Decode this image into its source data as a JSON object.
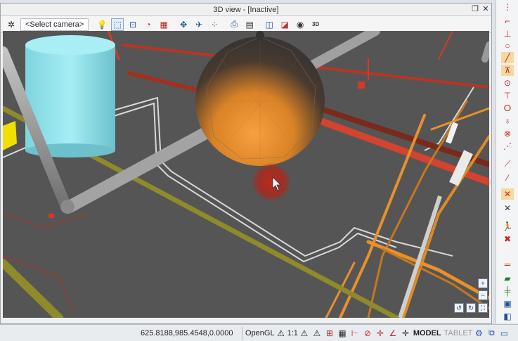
{
  "window": {
    "title": "3D view - [Inactive]",
    "restore_glyph": "❐",
    "close_glyph": "✕"
  },
  "toolbar": {
    "camera_select": "<Select camera>",
    "three_d_label": "3D",
    "icons": [
      "camera-settings-icon",
      "bulb-icon",
      "zoom-window-icon",
      "zoom-extents-icon",
      "orbit-2x-icon",
      "wall-icon",
      "walk-icon",
      "fly-icon",
      "path-icon",
      "print-icon",
      "print-preview-icon",
      "view-cube-icon",
      "render-icon",
      "eye-icon",
      "three-d-icon"
    ]
  },
  "navigation": {
    "zoom_in": "+",
    "zoom_out": "−",
    "rotate_left": "↺",
    "rotate_right": "↻",
    "fit": "⛶"
  },
  "status_bar": {
    "coordinates": "625.8188,985.4548,0.0000",
    "render_mode": "OpenGL",
    "scale": "1:1",
    "model_label": "MODEL",
    "tablet_label": "TABLET"
  },
  "colors": {
    "viewport_bg": "#555556",
    "accent_orange": "#e8902a",
    "pipe_red": "#d63a26",
    "pipe_grey": "#9c9c9c",
    "pipe_olive": "#8f8a2a",
    "tank_cyan": "#8fe1ea"
  }
}
